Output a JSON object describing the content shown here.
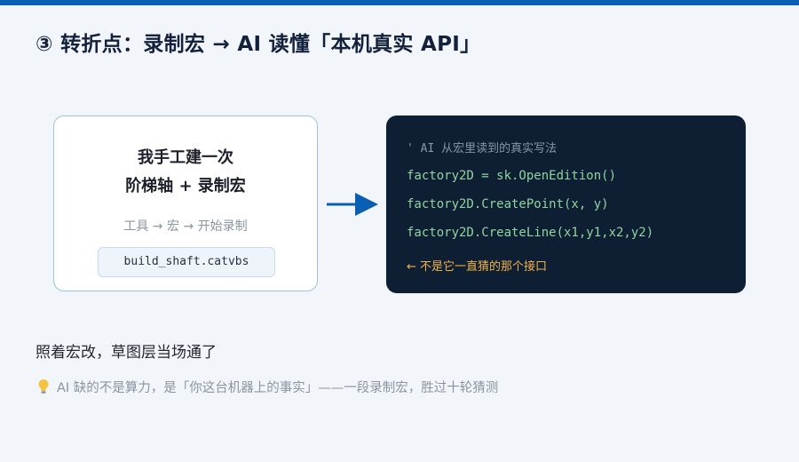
{
  "colors": {
    "top_bar": "#0b5fb3",
    "background": "#f2f6fa",
    "arrow": "#0b5fb3",
    "code_bg": "#0f1f33",
    "code_text": "#8ed4a0",
    "code_comment": "#8596ab",
    "code_note": "#f2b24a"
  },
  "header": {
    "title": "③ 转折点：录制宏 → AI 读懂「本机真实 API」"
  },
  "left_card": {
    "title_line1": "我手工建一次",
    "title_line2": "阶梯轴 + 录制宏",
    "subtitle": "工具 → 宏 → 开始录制",
    "filename": "build_shaft.catvbs"
  },
  "arrow_icon": "arrow-right-icon",
  "code_card": {
    "comment": "' AI 从宏里读到的真实写法",
    "lines": [
      "factory2D = sk.OpenEdition()",
      "factory2D.CreatePoint(x, y)",
      "factory2D.CreateLine(x1,y1,x2,y2)"
    ],
    "note": "← 不是它一直猜的那个接口"
  },
  "summary": "照着宏改，草图层当场通了",
  "tip": {
    "icon": "lightbulb-icon",
    "text": "AI 缺的不是算力，是「你这台机器上的事实」——一段录制宏，胜过十轮猜测"
  }
}
